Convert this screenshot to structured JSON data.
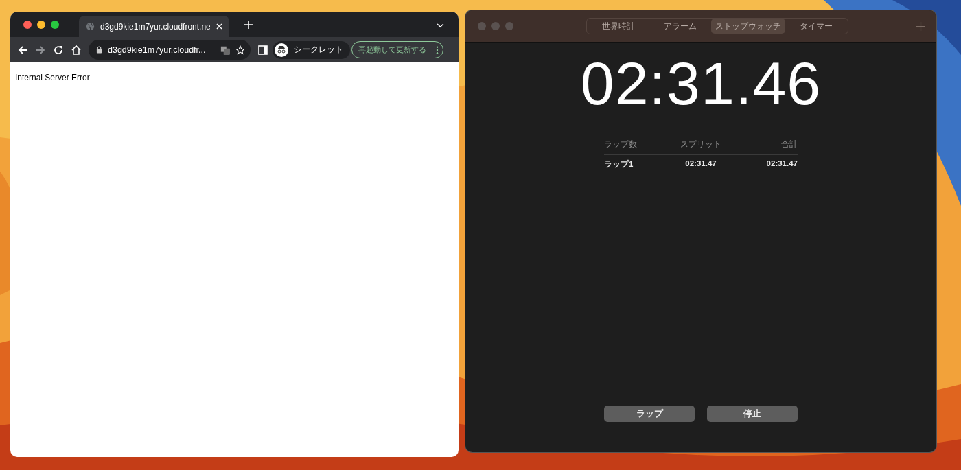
{
  "browser": {
    "tab_title": "d3gd9kie1m7yur.cloudfront.ne",
    "address": "d3gd9kie1m7yur.cloudfr...",
    "incognito_label": "シークレット",
    "update_button": "再起動して更新する",
    "page_text": "Internal Server Error"
  },
  "clock": {
    "tabs": [
      {
        "label": "世界時計",
        "selected": false
      },
      {
        "label": "アラーム",
        "selected": false
      },
      {
        "label": "ストップウォッチ",
        "selected": true
      },
      {
        "label": "タイマー",
        "selected": false
      }
    ],
    "time": "02:31.46",
    "lap_columns": [
      "ラップ数",
      "スプリット",
      "合計"
    ],
    "laps": [
      {
        "lap": "ラップ1",
        "split": "02:31.47",
        "total": "02:31.47"
      }
    ],
    "buttons": [
      "ラップ",
      "停止"
    ]
  }
}
